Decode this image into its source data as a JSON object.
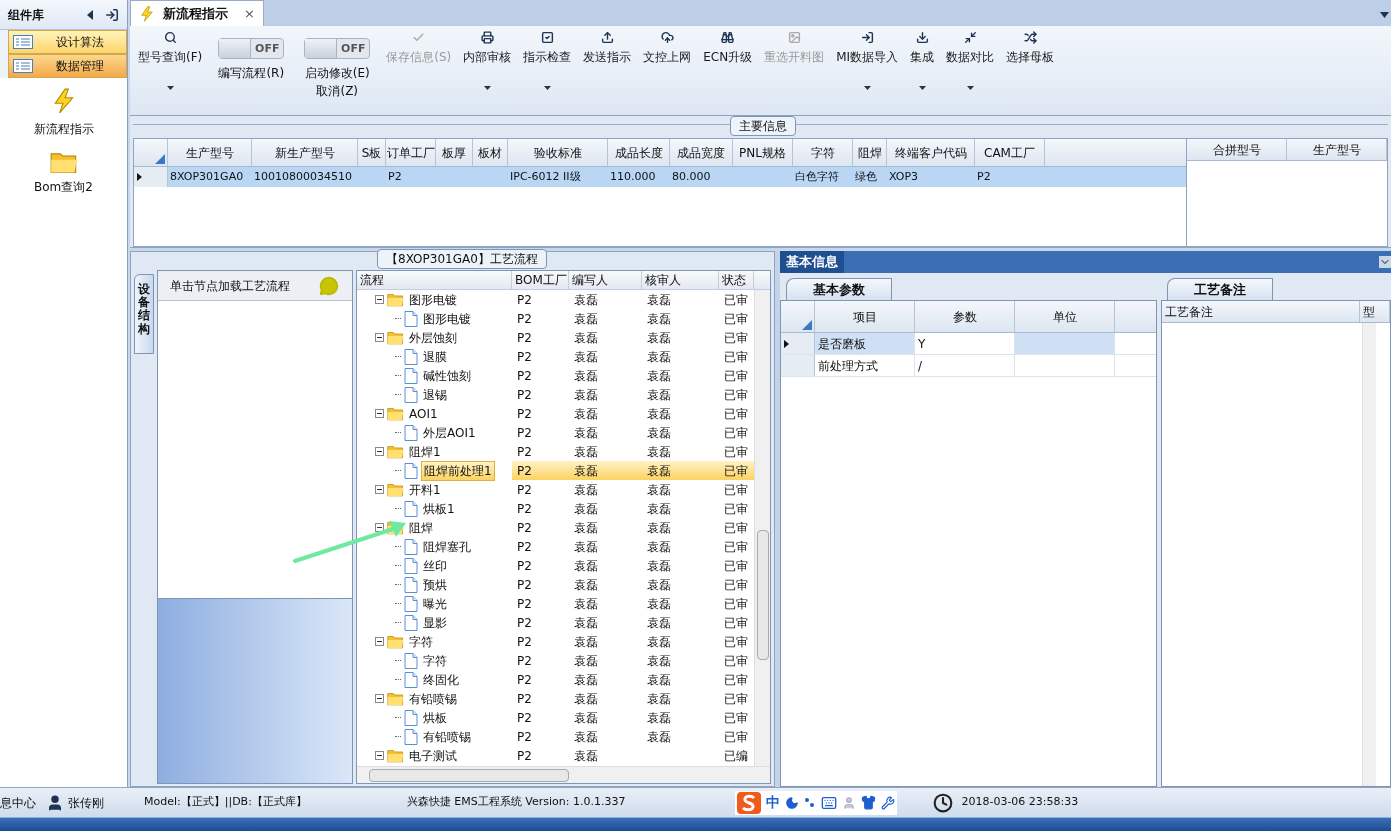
{
  "sidebar": {
    "title": "组件库",
    "items": [
      {
        "label": "设计算法",
        "selected": false
      },
      {
        "label": "数据管理",
        "selected": true
      }
    ],
    "shortcuts": [
      {
        "label": "新流程指示",
        "kind": "bolt"
      },
      {
        "label": "Bom查询2",
        "kind": "folder"
      }
    ]
  },
  "doc_tab": {
    "label": "新流程指示",
    "close": "×"
  },
  "toolbar": [
    {
      "kind": "button",
      "label": "型号查询(F)",
      "dropdown": true,
      "disabled": false
    },
    {
      "kind": "toggle",
      "label": "编写流程(R)",
      "state_text": "OFF",
      "on": false
    },
    {
      "kind": "toggle",
      "label": "启动修改(E)",
      "label2": "取消(Z)",
      "state_text": "OFF",
      "on": false
    },
    {
      "kind": "button",
      "label": "保存信息(S)",
      "dropdown": false,
      "disabled": true
    },
    {
      "kind": "button",
      "label": "内部审核",
      "dropdown": true,
      "disabled": false
    },
    {
      "kind": "button",
      "label": "指示检查",
      "dropdown": true,
      "disabled": false
    },
    {
      "kind": "button",
      "label": "发送指示",
      "dropdown": false,
      "disabled": false
    },
    {
      "kind": "button",
      "label": "文控上网",
      "dropdown": false,
      "disabled": false
    },
    {
      "kind": "button",
      "label": "ECN升级",
      "dropdown": false,
      "disabled": false
    },
    {
      "kind": "button",
      "label": "重选开料图",
      "dropdown": false,
      "disabled": true
    },
    {
      "kind": "button",
      "label": "MI数据导入",
      "dropdown": true,
      "disabled": false
    },
    {
      "kind": "button",
      "label": "集成",
      "dropdown": true,
      "disabled": false
    },
    {
      "kind": "button",
      "label": "数据对比",
      "dropdown": true,
      "disabled": false
    },
    {
      "kind": "button",
      "label": "选择母板",
      "dropdown": false,
      "disabled": false
    }
  ],
  "main_info": {
    "title": "主要信息",
    "columns": [
      "生产型号",
      "新生产型号",
      "S板",
      "订单工厂",
      "板厚",
      "板材",
      "验收标准",
      "成品长度",
      "成品宽度",
      "PNL规格",
      "字符",
      "阻焊",
      "终端客户代码",
      "CAM工厂"
    ],
    "rows": [
      {
        "selected": true,
        "cells": [
          "8XOP301GA0",
          "10010800034510",
          "",
          "P2",
          "",
          "",
          "IPC-6012 II级",
          "110.000",
          "80.000",
          "",
          "白色字符",
          "绿色",
          "XOP3",
          "P2"
        ]
      }
    ],
    "side_columns": [
      "合拼型号",
      "生产型号"
    ]
  },
  "flow": {
    "title": "【8XOP301GA0】工艺流程",
    "side_tab": "设备结构",
    "hint": "单击节点加载工艺流程",
    "columns": [
      "流程",
      "BOM工厂",
      "编写人",
      "核审人",
      "状态"
    ],
    "tree": [
      {
        "label": "图形电镀",
        "expanded": true,
        "cells": [
          "P2",
          "袁磊",
          "袁磊",
          "已审"
        ],
        "children": [
          {
            "label": "图形电镀",
            "selected": false,
            "cells": [
              "P2",
              "袁磊",
              "袁磊",
              "已审"
            ]
          }
        ]
      },
      {
        "label": "外层蚀刻",
        "expanded": true,
        "cells": [
          "P2",
          "袁磊",
          "袁磊",
          "已审"
        ],
        "children": [
          {
            "label": "退膜",
            "selected": false,
            "cells": [
              "P2",
              "袁磊",
              "袁磊",
              "已审"
            ]
          },
          {
            "label": "碱性蚀刻",
            "selected": false,
            "cells": [
              "P2",
              "袁磊",
              "袁磊",
              "已审"
            ]
          },
          {
            "label": "退锡",
            "selected": false,
            "cells": [
              "P2",
              "袁磊",
              "袁磊",
              "已审"
            ]
          }
        ]
      },
      {
        "label": "AOI1",
        "expanded": true,
        "cells": [
          "P2",
          "袁磊",
          "袁磊",
          "已审"
        ],
        "children": [
          {
            "label": "外层AOI1",
            "selected": false,
            "cells": [
              "P2",
              "袁磊",
              "袁磊",
              "已审"
            ]
          }
        ]
      },
      {
        "label": "阻焊1",
        "expanded": true,
        "cells": [
          "P2",
          "袁磊",
          "袁磊",
          "已审"
        ],
        "children": [
          {
            "label": "阻焊前处理1",
            "selected": true,
            "cells": [
              "P2",
              "袁磊",
              "袁磊",
              "已审"
            ]
          }
        ]
      },
      {
        "label": "开料1",
        "expanded": true,
        "cells": [
          "P2",
          "袁磊",
          "袁磊",
          "已审"
        ],
        "children": [
          {
            "label": "烘板1",
            "selected": false,
            "cells": [
              "P2",
              "袁磊",
              "袁磊",
              "已审"
            ]
          }
        ]
      },
      {
        "label": "阻焊",
        "expanded": true,
        "cells": [
          "P2",
          "袁磊",
          "袁磊",
          "已审"
        ],
        "children": [
          {
            "label": "阻焊塞孔",
            "selected": false,
            "cells": [
              "P2",
              "袁磊",
              "袁磊",
              "已审"
            ]
          },
          {
            "label": "丝印",
            "selected": false,
            "cells": [
              "P2",
              "袁磊",
              "袁磊",
              "已审"
            ]
          },
          {
            "label": "预烘",
            "selected": false,
            "cells": [
              "P2",
              "袁磊",
              "袁磊",
              "已审"
            ]
          },
          {
            "label": "曝光",
            "selected": false,
            "cells": [
              "P2",
              "袁磊",
              "袁磊",
              "已审"
            ]
          },
          {
            "label": "显影",
            "selected": false,
            "cells": [
              "P2",
              "袁磊",
              "袁磊",
              "已审"
            ]
          }
        ]
      },
      {
        "label": "字符",
        "expanded": true,
        "cells": [
          "P2",
          "袁磊",
          "袁磊",
          "已审"
        ],
        "children": [
          {
            "label": "字符",
            "selected": false,
            "cells": [
              "P2",
              "袁磊",
              "袁磊",
              "已审"
            ]
          },
          {
            "label": "终固化",
            "selected": false,
            "cells": [
              "P2",
              "袁磊",
              "袁磊",
              "已审"
            ]
          }
        ]
      },
      {
        "label": "有铅喷锡",
        "expanded": true,
        "cells": [
          "P2",
          "袁磊",
          "袁磊",
          "已审"
        ],
        "children": [
          {
            "label": "烘板",
            "selected": false,
            "cells": [
              "P2",
              "袁磊",
              "袁磊",
              "已审"
            ]
          },
          {
            "label": "有铅喷锡",
            "selected": false,
            "cells": [
              "P2",
              "袁磊",
              "袁磊",
              "已审"
            ]
          }
        ]
      },
      {
        "label": "电子测试",
        "expanded": true,
        "cells": [
          "P2",
          "袁磊",
          "",
          "已编"
        ]
      }
    ]
  },
  "basic_info": {
    "title": "基本信息",
    "tab": "基本参数",
    "columns": [
      "项目",
      "参数",
      "单位"
    ],
    "rows": [
      {
        "selected": true,
        "cells": [
          "是否磨板",
          "Y",
          ""
        ]
      },
      {
        "selected": false,
        "cells": [
          "前处理方式",
          "/",
          ""
        ]
      }
    ]
  },
  "remarks": {
    "tab": "工艺备注",
    "columns": [
      "工艺备注",
      "型"
    ]
  },
  "status_bar": {
    "left": "息中心",
    "user": "张传刚",
    "db": "Model:【正式】||DB:【正式库】",
    "app": "兴森快捷 EMS工程系统 Version: 1.0.1.337",
    "ime": "中",
    "time": "2018-03-06 23:58:33"
  }
}
